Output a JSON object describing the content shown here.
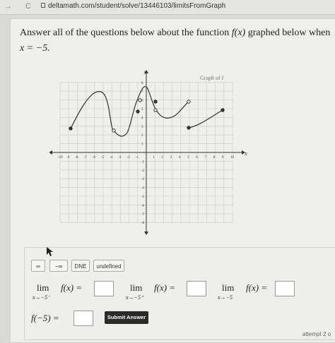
{
  "browser": {
    "back_glyph": "→",
    "reload_glyph": "C",
    "url": "deltamath.com/student/solve/13446103/limitsFromGraph"
  },
  "question": {
    "text_part1": "Answer all of the questions below about the function ",
    "func": "f(x)",
    "text_part2": " graphed below when",
    "text_line2": "x = −5."
  },
  "graph": {
    "title": "Graph of f",
    "x_axis_label": "x",
    "y_axis_label": "y",
    "x_ticks": [
      "-10",
      "-9",
      "-8",
      "-7",
      "-6",
      "-5",
      "-4",
      "-3",
      "-2",
      "-1",
      "1",
      "2",
      "3",
      "4",
      "5",
      "6",
      "7",
      "8",
      "9",
      "10"
    ],
    "y_ticks": [
      "8",
      "7",
      "6",
      "5",
      "4",
      "3",
      "2",
      "1",
      "-1",
      "-2",
      "-3",
      "-4",
      "-5",
      "-6",
      "-7",
      "-8"
    ]
  },
  "symbol_buttons": {
    "infinity": "∞",
    "neg_infinity": "−∞",
    "dne": "DNE",
    "undefined": "undefined"
  },
  "limits": {
    "lim_word": "lim",
    "left_sub": "x→−5⁻",
    "right_sub": "x→−5⁺",
    "two_sided_sub": "x→−5",
    "fx_eq": "f(x) ="
  },
  "value_prompt": "f(−5) =",
  "submit_label": "Submit Answer",
  "attempt_text": "attempt 2 o"
}
